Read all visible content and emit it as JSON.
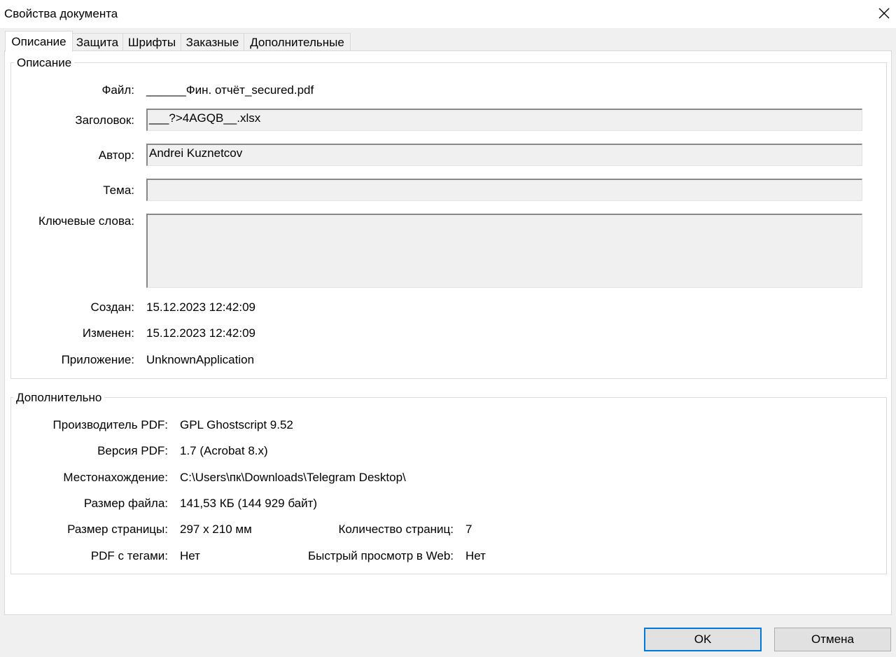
{
  "window": {
    "title": "Свойства документа"
  },
  "tabs": [
    {
      "label": "Описание",
      "active": true
    },
    {
      "label": "Защита"
    },
    {
      "label": "Шрифты"
    },
    {
      "label": "Заказные"
    },
    {
      "label": "Дополнительные"
    }
  ],
  "description": {
    "legend": "Описание",
    "file_label": "Файл:",
    "file_value": "______Фин. отчёт_secured.pdf",
    "title_label": "Заголовок:",
    "title_value": "___?>4AGQB__.xlsx",
    "author_label": "Автор:",
    "author_value": "Andrei Kuznetcov",
    "subject_label": "Тема:",
    "subject_value": "",
    "keywords_label": "Ключевые слова:",
    "keywords_value": "",
    "created_label": "Создан:",
    "created_value": "15.12.2023 12:42:09",
    "modified_label": "Изменен:",
    "modified_value": "15.12.2023 12:42:09",
    "app_label": "Приложение:",
    "app_value": "UnknownApplication"
  },
  "advanced": {
    "legend": "Дополнительно",
    "producer_label": "Производитель PDF:",
    "producer_value": "GPL Ghostscript 9.52",
    "version_label": "Версия PDF:",
    "version_value": "1.7 (Acrobat 8.x)",
    "location_label": "Местонахождение:",
    "location_value": "C:\\Users\\пк\\Downloads\\Telegram Desktop\\",
    "filesize_label": "Размер файла:",
    "filesize_value": "141,53 КБ (144 929 байт)",
    "pagesize_label": "Размер страницы:",
    "pagesize_value": "297 x 210 мм",
    "pagecount_label": "Количество страниц:",
    "pagecount_value": "7",
    "tagged_label": "PDF с тегами:",
    "tagged_value": "Нет",
    "fastweb_label": "Быстрый просмотр в Web:",
    "fastweb_value": "Нет"
  },
  "buttons": {
    "ok": "OK",
    "cancel": "Отмена"
  },
  "colors": {
    "default_button_border": "#0078d7",
    "panel_bg": "#ffffff",
    "window_bg": "#f0f0f0"
  },
  "icons": {
    "close": "close-icon"
  }
}
